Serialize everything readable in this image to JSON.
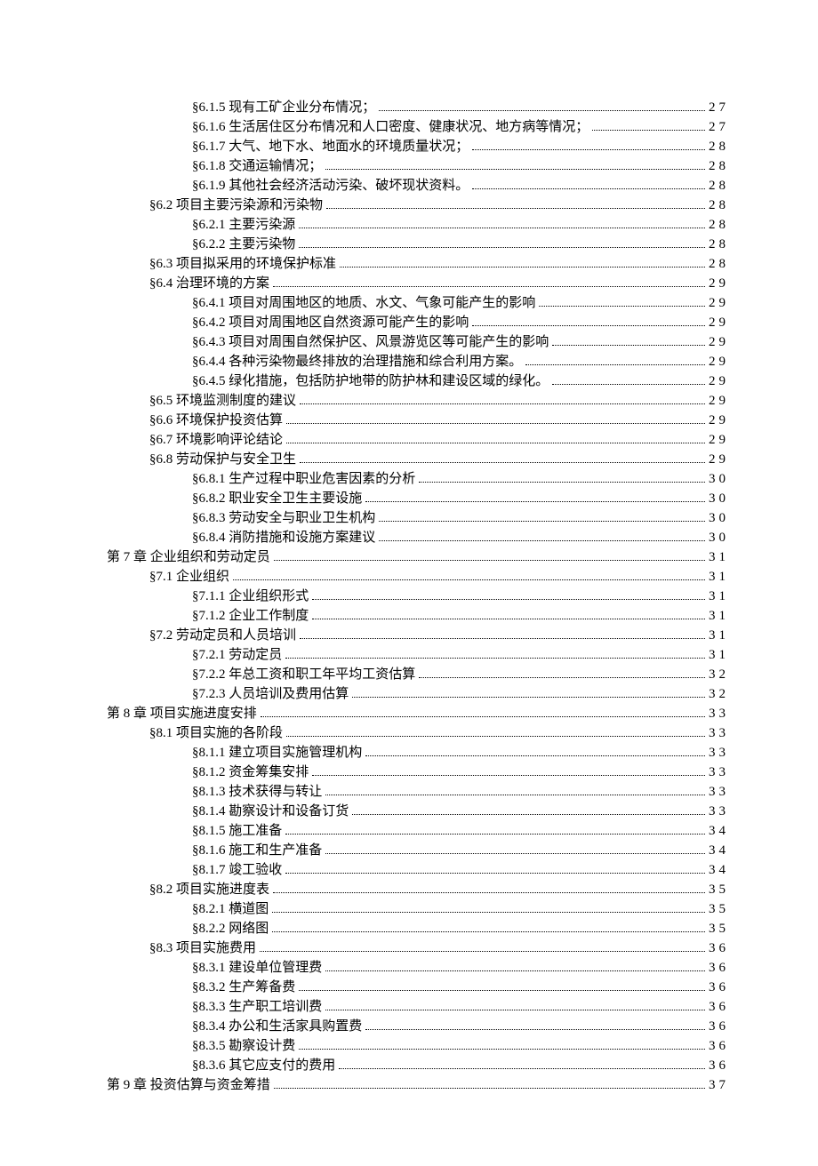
{
  "toc": [
    {
      "level": 2,
      "label": "§6.1.5 现有工矿企业分布情况；",
      "page": "27"
    },
    {
      "level": 2,
      "label": "§6.1.6 生活居住区分布情况和人口密度、健康状况、地方病等情况；",
      "page": "27"
    },
    {
      "level": 2,
      "label": "§6.1.7 大气、地下水、地面水的环境质量状况；",
      "page": "28"
    },
    {
      "level": 2,
      "label": "§6.1.8 交通运输情况；",
      "page": "28"
    },
    {
      "level": 2,
      "label": "§6.1.9 其他社会经济活动污染、破坏现状资料。",
      "page": "28"
    },
    {
      "level": 1,
      "label": "§6.2 项目主要污染源和污染物",
      "page": "28"
    },
    {
      "level": 2,
      "label": "§6.2.1 主要污染源",
      "page": "28"
    },
    {
      "level": 2,
      "label": "§6.2.2 主要污染物",
      "page": "28"
    },
    {
      "level": 1,
      "label": "§6.3 项目拟采用的环境保护标准",
      "page": "28"
    },
    {
      "level": 1,
      "label": "§6.4 治理环境的方案",
      "page": "29"
    },
    {
      "level": 2,
      "label": "§6.4.1 项目对周围地区的地质、水文、气象可能产生的影响",
      "page": "29"
    },
    {
      "level": 2,
      "label": "§6.4.2 项目对周围地区自然资源可能产生的影响",
      "page": "29"
    },
    {
      "level": 2,
      "label": "§6.4.3 项目对周围自然保护区、风景游览区等可能产生的影响",
      "page": "29"
    },
    {
      "level": 2,
      "label": "§6.4.4 各种污染物最终排放的治理措施和综合利用方案。",
      "page": "29"
    },
    {
      "level": 2,
      "label": "§6.4.5 绿化措施，包括防护地带的防护林和建设区域的绿化。",
      "page": "29"
    },
    {
      "level": 1,
      "label": "§6.5 环境监测制度的建议",
      "page": "29"
    },
    {
      "level": 1,
      "label": "§6.6 环境保护投资估算",
      "page": "29"
    },
    {
      "level": 1,
      "label": "§6.7 环境影响评论结论",
      "page": "29"
    },
    {
      "level": 1,
      "label": "§6.8 劳动保护与安全卫生",
      "page": "29"
    },
    {
      "level": 2,
      "label": "§6.8.1 生产过程中职业危害因素的分析",
      "page": "30"
    },
    {
      "level": 2,
      "label": "§6.8.2 职业安全卫生主要设施",
      "page": "30"
    },
    {
      "level": 2,
      "label": "§6.8.3 劳动安全与职业卫生机构",
      "page": "30"
    },
    {
      "level": 2,
      "label": "§6.8.4 消防措施和设施方案建议",
      "page": "30"
    },
    {
      "level": 0,
      "label": "第 7 章 企业组织和劳动定员",
      "page": "31"
    },
    {
      "level": 1,
      "label": "§7.1 企业组织",
      "page": "31"
    },
    {
      "level": 2,
      "label": "§7.1.1 企业组织形式",
      "page": "31"
    },
    {
      "level": 2,
      "label": "§7.1.2 企业工作制度",
      "page": "31"
    },
    {
      "level": 1,
      "label": "§7.2 劳动定员和人员培训",
      "page": "31"
    },
    {
      "level": 2,
      "label": "§7.2.1 劳动定员",
      "page": "31"
    },
    {
      "level": 2,
      "label": "§7.2.2 年总工资和职工年平均工资估算",
      "page": "32"
    },
    {
      "level": 2,
      "label": "§7.2.3 人员培训及费用估算",
      "page": "32"
    },
    {
      "level": 0,
      "label": "第 8 章 项目实施进度安排",
      "page": "33"
    },
    {
      "level": 1,
      "label": "§8.1 项目实施的各阶段",
      "page": "33"
    },
    {
      "level": 2,
      "label": "§8.1.1 建立项目实施管理机构",
      "page": "33"
    },
    {
      "level": 2,
      "label": "§8.1.2 资金筹集安排",
      "page": "33"
    },
    {
      "level": 2,
      "label": "§8.1.3 技术获得与转让",
      "page": "33"
    },
    {
      "level": 2,
      "label": "§8.1.4 勘察设计和设备订货",
      "page": "33"
    },
    {
      "level": 2,
      "label": "§8.1.5 施工准备",
      "page": "34"
    },
    {
      "level": 2,
      "label": "§8.1.6 施工和生产准备",
      "page": "34"
    },
    {
      "level": 2,
      "label": "§8.1.7 竣工验收",
      "page": "34"
    },
    {
      "level": 1,
      "label": "§8.2 项目实施进度表",
      "page": "35"
    },
    {
      "level": 2,
      "label": "§8.2.1 横道图",
      "page": "35"
    },
    {
      "level": 2,
      "label": "§8.2.2 网络图",
      "page": "35"
    },
    {
      "level": 1,
      "label": "§8.3 项目实施费用",
      "page": "36"
    },
    {
      "level": 2,
      "label": "§8.3.1 建设单位管理费",
      "page": "36"
    },
    {
      "level": 2,
      "label": "§8.3.2 生产筹备费",
      "page": "36"
    },
    {
      "level": 2,
      "label": "§8.3.3 生产职工培训费",
      "page": "36"
    },
    {
      "level": 2,
      "label": "§8.3.4 办公和生活家具购置费",
      "page": "36"
    },
    {
      "level": 2,
      "label": "§8.3.5 勘察设计费",
      "page": "36"
    },
    {
      "level": 2,
      "label": "§8.3.6 其它应支付的费用",
      "page": "36"
    },
    {
      "level": 0,
      "label": "第 9 章 投资估算与资金筹措",
      "page": "37"
    }
  ]
}
